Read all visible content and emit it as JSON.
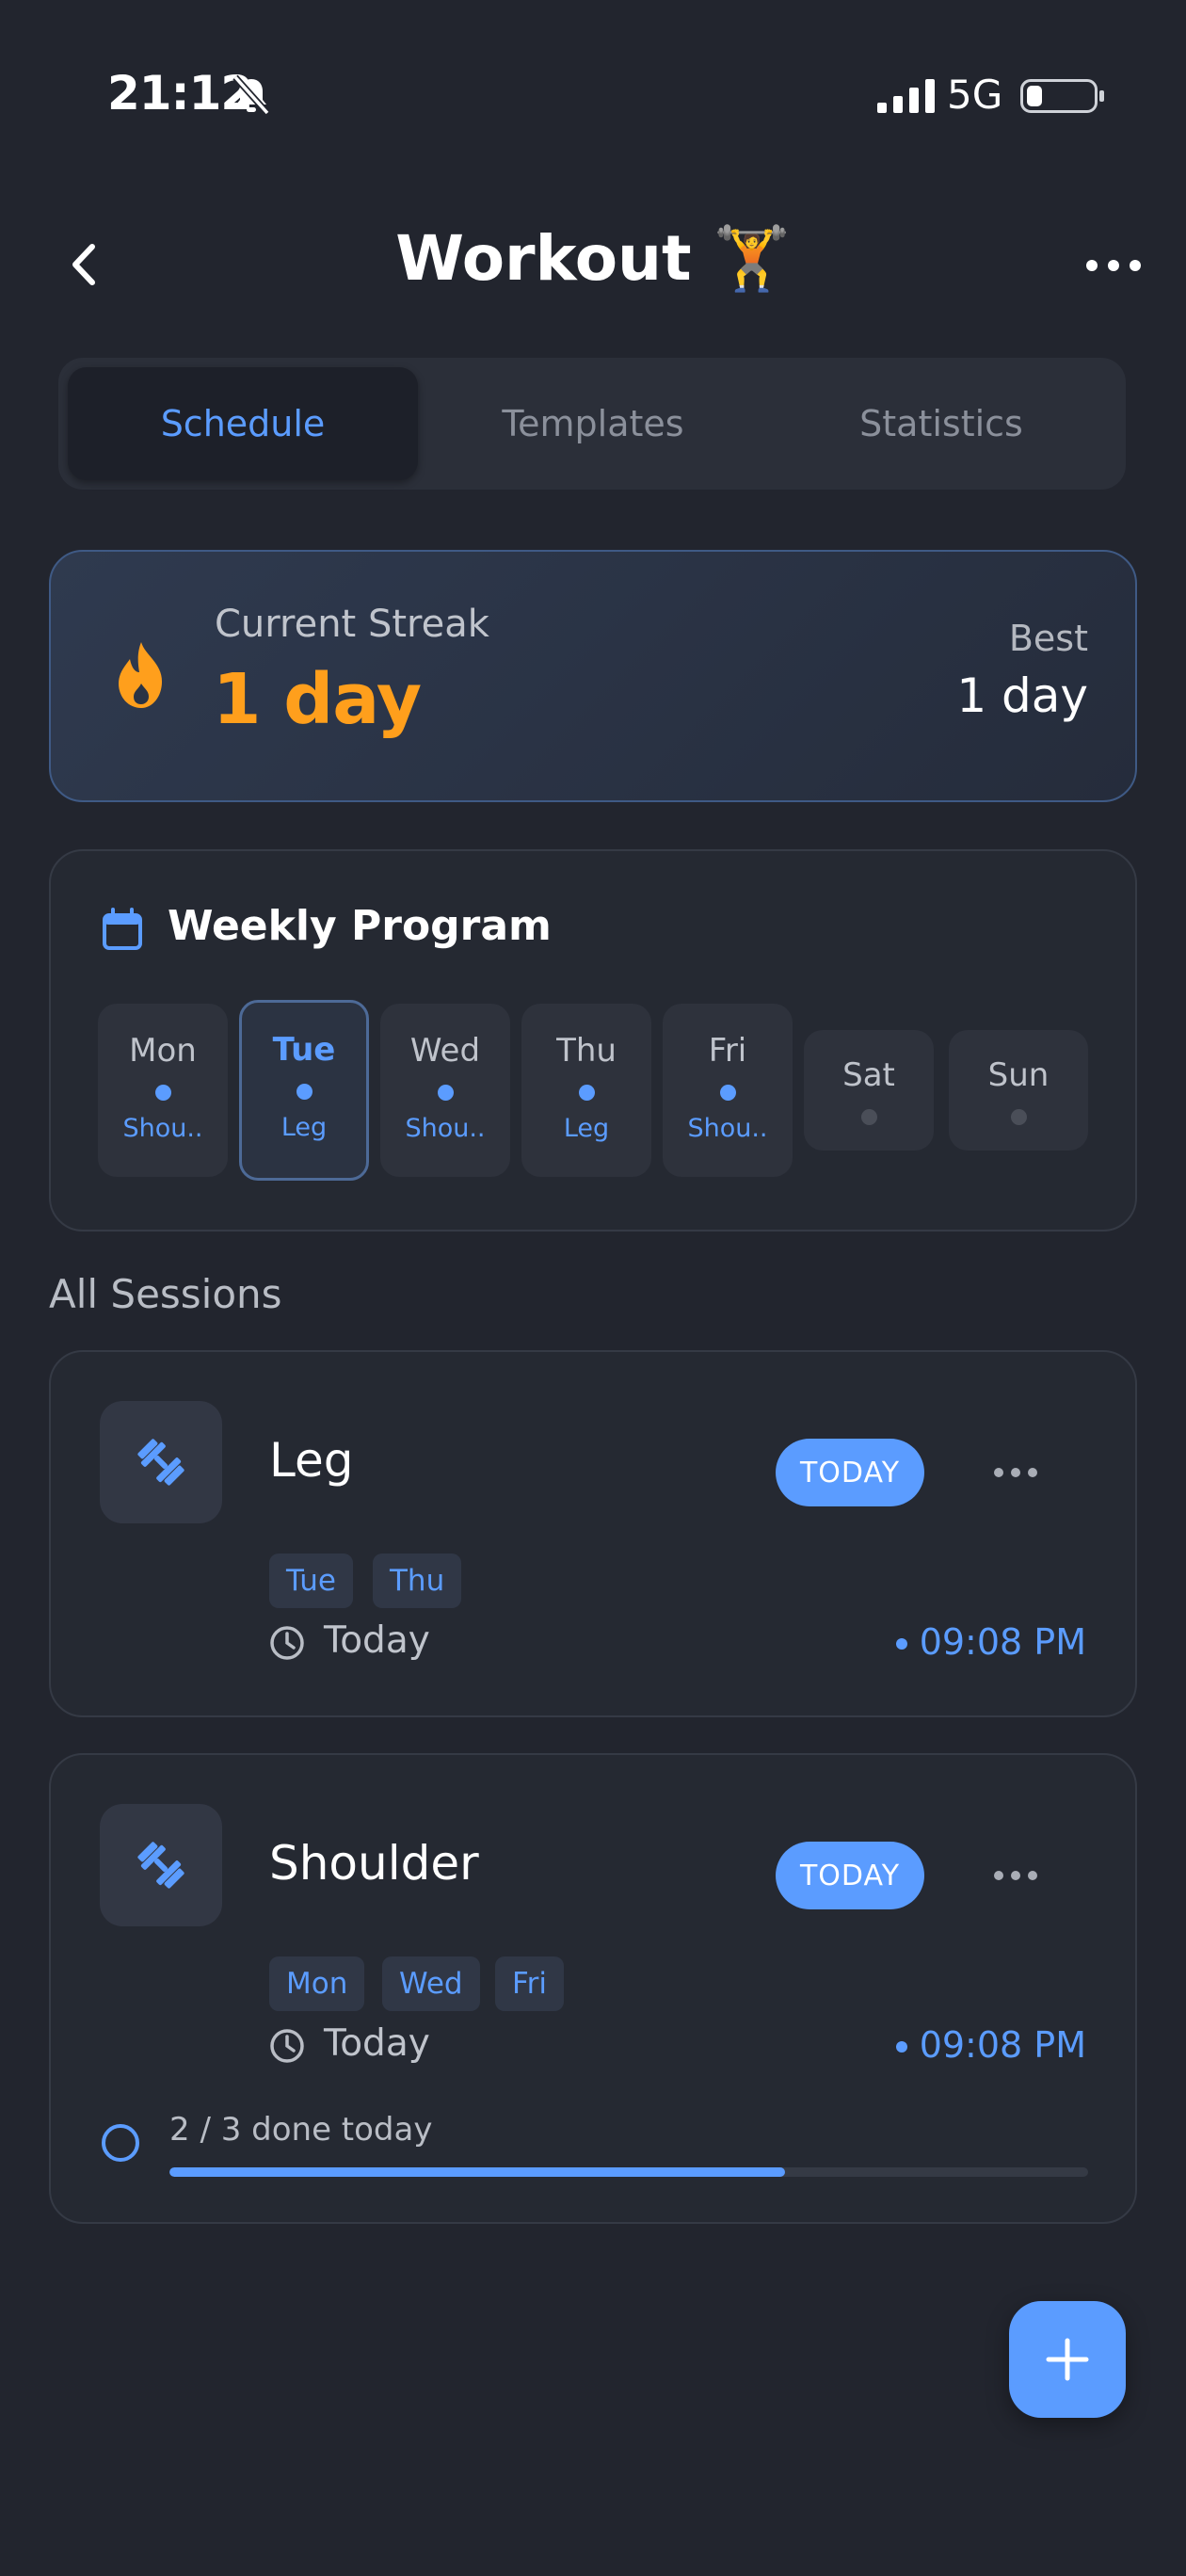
{
  "status_bar": {
    "time": "21:12",
    "network": "5G",
    "battery_level": 0.15
  },
  "header": {
    "title": "Workout 🏋️"
  },
  "tabs": [
    {
      "label": "Schedule",
      "active": true
    },
    {
      "label": "Templates",
      "active": false
    },
    {
      "label": "Statistics",
      "active": false
    }
  ],
  "streak": {
    "label": "Current Streak",
    "value": "1 day",
    "best_label": "Best",
    "best_value": "1 day"
  },
  "weekly": {
    "title": "Weekly Program",
    "days": [
      {
        "name": "Mon",
        "label": "Shou..",
        "scheduled": true
      },
      {
        "name": "Tue",
        "label": "Leg",
        "scheduled": true,
        "active": true
      },
      {
        "name": "Wed",
        "label": "Shou..",
        "scheduled": true
      },
      {
        "name": "Thu",
        "label": "Leg",
        "scheduled": true
      },
      {
        "name": "Fri",
        "label": "Shou..",
        "scheduled": true
      },
      {
        "name": "Sat",
        "label": "",
        "scheduled": false
      },
      {
        "name": "Sun",
        "label": "",
        "scheduled": false
      }
    ]
  },
  "sessions_title": "All Sessions",
  "sessions": [
    {
      "name": "Leg",
      "badge": "TODAY",
      "days": [
        "Tue",
        "Thu"
      ],
      "when": "Today",
      "time": "09:08 PM"
    },
    {
      "name": "Shoulder",
      "badge": "TODAY",
      "days": [
        "Mon",
        "Wed",
        "Fri"
      ],
      "when": "Today",
      "time": "09:08 PM",
      "progress_text": "2 / 3 done today",
      "progress": 0.67
    }
  ],
  "colors": {
    "accent": "#5b9cff",
    "streak": "#ff9f1c",
    "background": "#22252e",
    "card": "#252932"
  },
  "icons": [
    "bell-slash-icon",
    "signal-icon",
    "battery-icon",
    "back-chevron-icon",
    "more-icon",
    "flame-icon",
    "calendar-icon",
    "dumbbell-icon",
    "clock-icon",
    "plus-icon"
  ]
}
